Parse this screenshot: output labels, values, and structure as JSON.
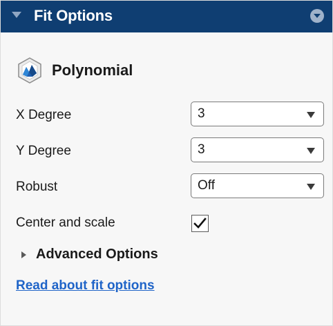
{
  "header": {
    "title": "Fit Options",
    "colors": {
      "background": "#0f3e72",
      "text": "#ffffff"
    },
    "collapse_icon": "triangle-down-icon",
    "menu_icon": "circle-chevron-down-icon"
  },
  "fit_type": {
    "label": "Polynomial",
    "icon": "polynomial-surface-icon"
  },
  "options": {
    "x_degree": {
      "label": "X Degree",
      "value": "3"
    },
    "y_degree": {
      "label": "Y Degree",
      "value": "3"
    },
    "robust": {
      "label": "Robust",
      "value": "Off"
    },
    "center_and_scale": {
      "label": "Center and scale",
      "checked": true
    }
  },
  "advanced": {
    "label": "Advanced Options",
    "icon": "triangle-right-icon"
  },
  "link": {
    "label": "Read about fit options",
    "color": "#1f64c8"
  }
}
